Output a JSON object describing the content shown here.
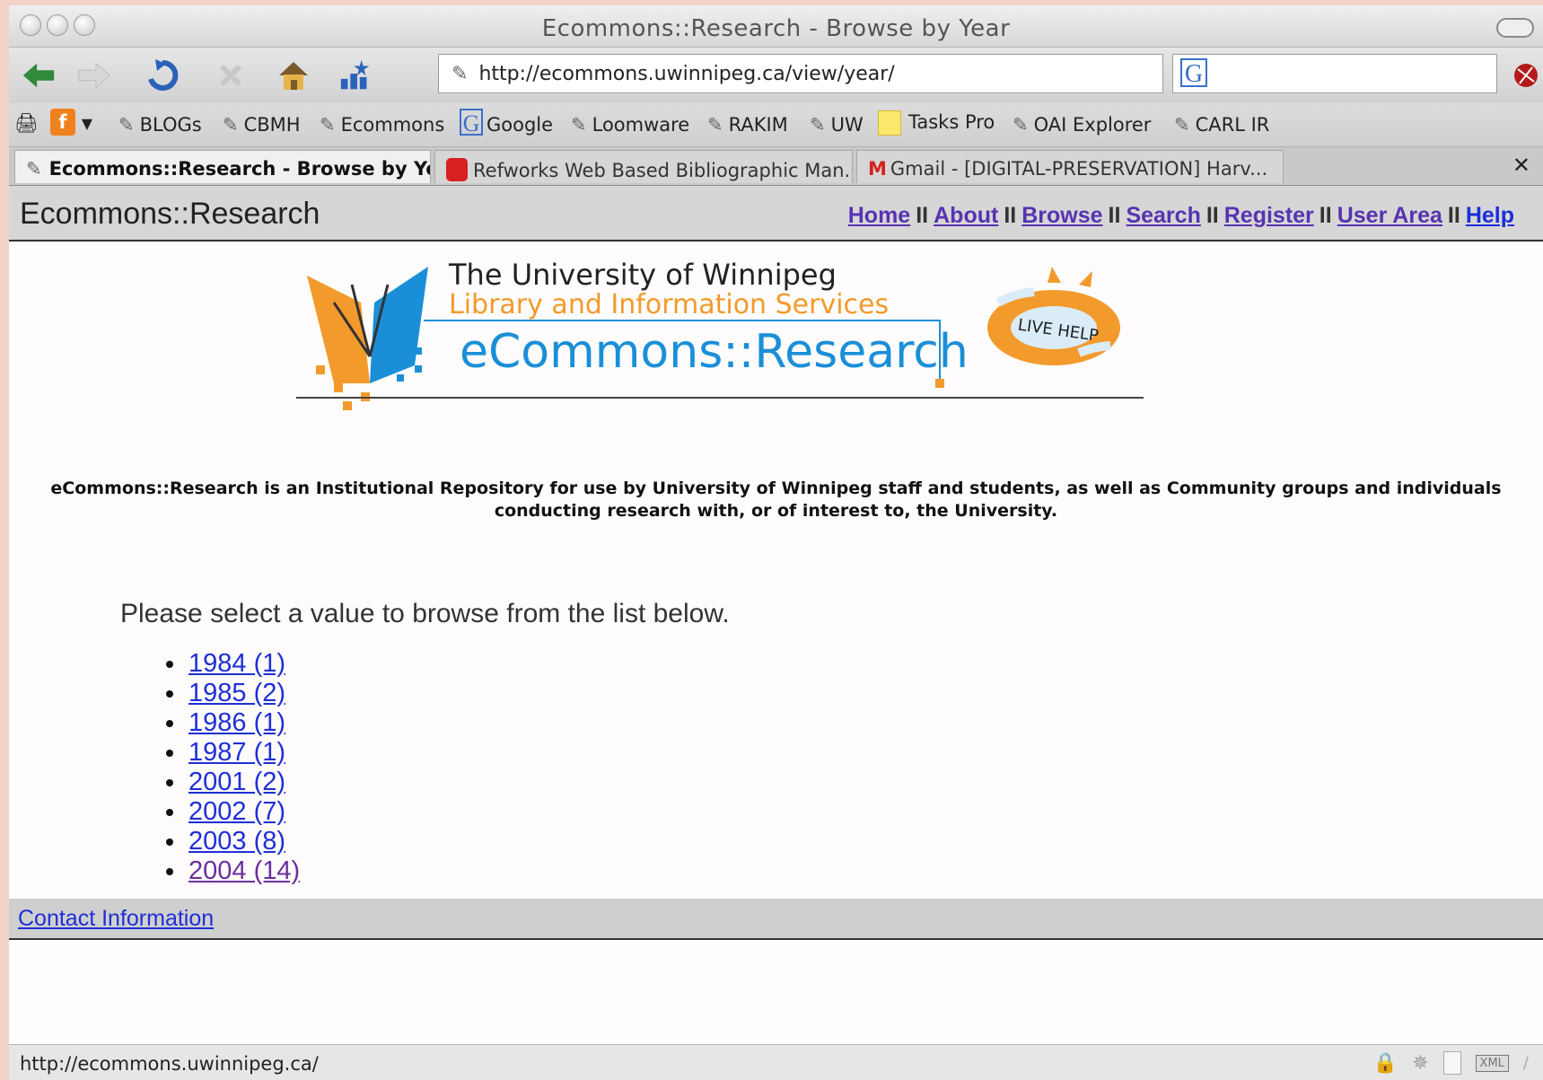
{
  "window": {
    "title": "Ecommons::Research - Browse by Year"
  },
  "toolbar": {
    "url": "http://ecommons.uwinnipeg.ca/view/year/",
    "search_engine_icon": "G",
    "search_value": ""
  },
  "bookmarks": [
    {
      "label": "BLOGs",
      "icon": "bookmark-icon"
    },
    {
      "label": "CBMH",
      "icon": "bookmark-icon"
    },
    {
      "label": "Ecommons",
      "icon": "bookmark-icon"
    },
    {
      "label": "Google",
      "icon": "google-icon"
    },
    {
      "label": "Loomware",
      "icon": "bookmark-icon"
    },
    {
      "label": "RAKIM",
      "icon": "bookmark-icon"
    },
    {
      "label": "UW",
      "icon": "bookmark-icon"
    },
    {
      "label": "Tasks Pro",
      "icon": "sticky-note-icon"
    },
    {
      "label": "OAI Explorer",
      "icon": "bookmark-icon"
    },
    {
      "label": "CARL IR",
      "icon": "bookmark-icon"
    }
  ],
  "tabs": [
    {
      "label": "Ecommons::Research - Browse by Ye...",
      "active": true
    },
    {
      "label": "Refworks Web Based Bibliographic Man...",
      "active": false
    },
    {
      "label": "Gmail - [DIGITAL-PRESERVATION] Harv...",
      "active": false
    }
  ],
  "site": {
    "title": "Ecommons::Research",
    "nav": {
      "home": "Home",
      "about": "About",
      "browse": "Browse",
      "search": "Search",
      "register": "Register",
      "user_area": "User Area",
      "help": "Help",
      "separator": "II"
    },
    "banner": {
      "university": "The University of Winnipeg",
      "department": "Library and Information Services",
      "repository": "eCommons::Research",
      "live_help": "LIVE HELP"
    },
    "intro_line1": "eCommons::Research is an Institutional Repository for use by University of Winnipeg staff and students, as well as Community groups and individuals",
    "intro_line2": "conducting research with, or of interest to, the University.",
    "prompt": "Please select a value to browse from the list below.",
    "years": [
      {
        "label": "1984 (1)",
        "visited": false
      },
      {
        "label": "1985 (2)",
        "visited": false
      },
      {
        "label": "1986 (1)",
        "visited": false
      },
      {
        "label": "1987 (1)",
        "visited": false
      },
      {
        "label": "2001 (2)",
        "visited": false
      },
      {
        "label": "2002 (7)",
        "visited": false
      },
      {
        "label": "2003 (8)",
        "visited": false
      },
      {
        "label": "2004 (14)",
        "visited": true
      }
    ],
    "footer_link": "Contact Information"
  },
  "status": {
    "text": "http://ecommons.uwinnipeg.ca/",
    "xml_badge": "XML"
  },
  "colors": {
    "link": "#1f2fd6",
    "visited": "#6b2f9e",
    "banner_blue": "#1a8fd8",
    "banner_orange": "#f39a2c"
  }
}
